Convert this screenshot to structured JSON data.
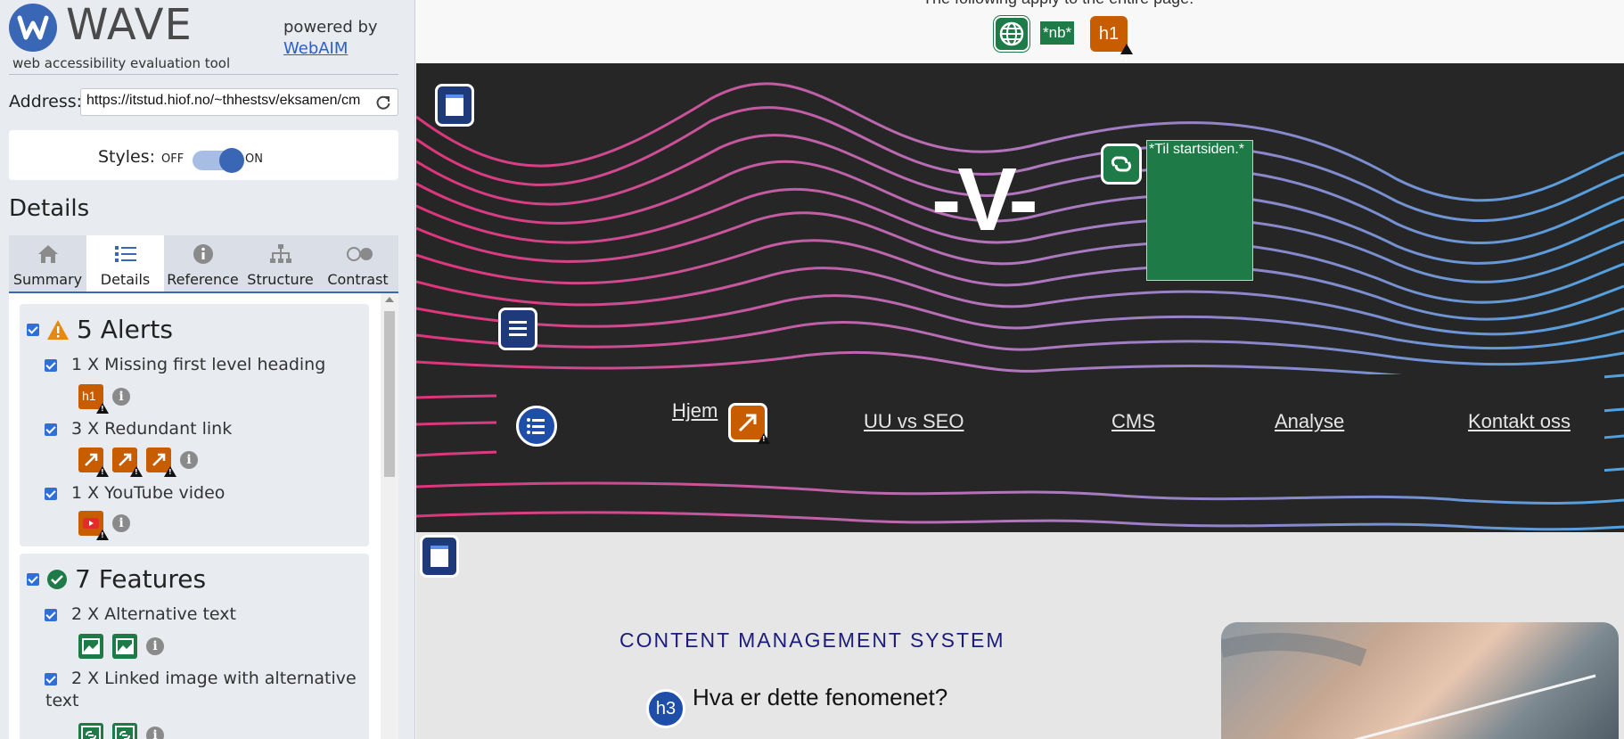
{
  "wave": {
    "logo_word": "WAVE",
    "tagline": "web accessibility evaluation tool",
    "powered_by": "powered by",
    "powered_link": "WebAIM",
    "address_label": "Address:",
    "address_value": "https://itstud.hiof.no/~thhestsv/eksamen/cm",
    "styles_label": "Styles:",
    "styles_off": "OFF",
    "styles_on": "ON",
    "details_heading": "Details",
    "tabs": [
      {
        "label": "Summary",
        "icon": "home-icon"
      },
      {
        "label": "Details",
        "icon": "list-icon"
      },
      {
        "label": "Reference",
        "icon": "info-icon"
      },
      {
        "label": "Structure",
        "icon": "sitemap-icon"
      },
      {
        "label": "Contrast",
        "icon": "contrast-icon"
      }
    ],
    "active_tab": "Details",
    "alerts": {
      "title": "5 Alerts",
      "items": [
        {
          "label": "1 X Missing first level heading",
          "icons": 1,
          "icon_text": "h1"
        },
        {
          "label": "3 X Redundant link",
          "icons": 3
        },
        {
          "label": "1 X YouTube video",
          "icons": 1
        }
      ]
    },
    "features": {
      "title": "7 Features",
      "items": [
        {
          "label": "2 X Alternative text",
          "icons": 2
        },
        {
          "label": "2 X Linked image with alternative",
          "label_cont": "text",
          "icons": 2
        }
      ]
    }
  },
  "page": {
    "top_note": "The following apply to the entire page:",
    "nb_badge": "*nb*",
    "h1_badge": "h1",
    "tooltip": "*Til startsiden.*",
    "logo_text": "-V-",
    "nav": [
      "Hjem",
      "UU vs SEO",
      "CMS",
      "Analyse",
      "Kontakt oss"
    ],
    "cms_heading": "CONTENT MANAGEMENT SYSTEM",
    "h3_icon": "h3",
    "sub_heading": "Hva er dette fenomenet?"
  },
  "colors": {
    "wave_blue": "#3a67b5",
    "alert_orange": "#c85d00",
    "feature_green": "#1e7a46",
    "hero_bg": "#262626"
  }
}
